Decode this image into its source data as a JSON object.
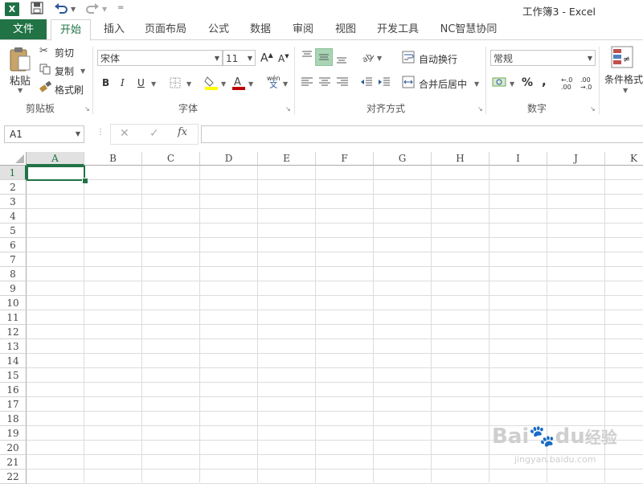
{
  "window": {
    "title": "工作簿3 - Excel",
    "app_icon": "X"
  },
  "quick_access": {
    "save_icon": "save-icon",
    "undo_icon": "undo-icon",
    "redo_icon": "redo-icon",
    "customize_icon": "customize-icon"
  },
  "tabs": [
    {
      "label": "文件"
    },
    {
      "label": "开始"
    },
    {
      "label": "插入"
    },
    {
      "label": "页面布局"
    },
    {
      "label": "公式"
    },
    {
      "label": "数据"
    },
    {
      "label": "审阅"
    },
    {
      "label": "视图"
    },
    {
      "label": "开发工具"
    },
    {
      "label": "NC智慧协同"
    }
  ],
  "active_tab": "开始",
  "ribbon": {
    "clipboard": {
      "paste": "粘贴",
      "cut": "剪切",
      "copy": "复制",
      "format_painter": "格式刷",
      "group_label": "剪贴板"
    },
    "font": {
      "font_name": "宋体",
      "font_size": "11",
      "bold": "B",
      "italic": "I",
      "underline": "U",
      "grow": "A",
      "shrink": "A",
      "phonetic_top": "wén",
      "phonetic_bottom": "文",
      "group_label": "字体"
    },
    "alignment": {
      "wrap_text": "自动换行",
      "merge_center": "合并后居中",
      "group_label": "对齐方式"
    },
    "number": {
      "format": "常规",
      "percent": "%",
      "comma": ",",
      "inc_decimal_top": "←.0",
      "inc_decimal_bottom": ".00",
      "dec_decimal_top": ".00",
      "dec_decimal_bottom": "→.0",
      "group_label": "数字"
    },
    "styles": {
      "conditional_formatting": "条件格式"
    }
  },
  "formula_bar": {
    "name_box": "A1",
    "cancel": "✕",
    "enter": "✓",
    "fx": "fx",
    "value": ""
  },
  "sheet": {
    "columns": [
      "A",
      "B",
      "C",
      "D",
      "E",
      "F",
      "G",
      "H",
      "I",
      "J",
      "K"
    ],
    "rows": [
      "1",
      "2",
      "3",
      "4",
      "5",
      "6",
      "7",
      "8",
      "9",
      "10",
      "11",
      "12",
      "13",
      "14",
      "15",
      "16",
      "17",
      "18",
      "19",
      "20",
      "21",
      "22"
    ],
    "active_cell": "A1"
  },
  "watermark": {
    "brand": "Bai",
    "brand2": "du",
    "suffix": "经验",
    "url": "jingyan.baidu.com"
  },
  "colors": {
    "accent": "#217346",
    "grid": "#dadcdd"
  }
}
